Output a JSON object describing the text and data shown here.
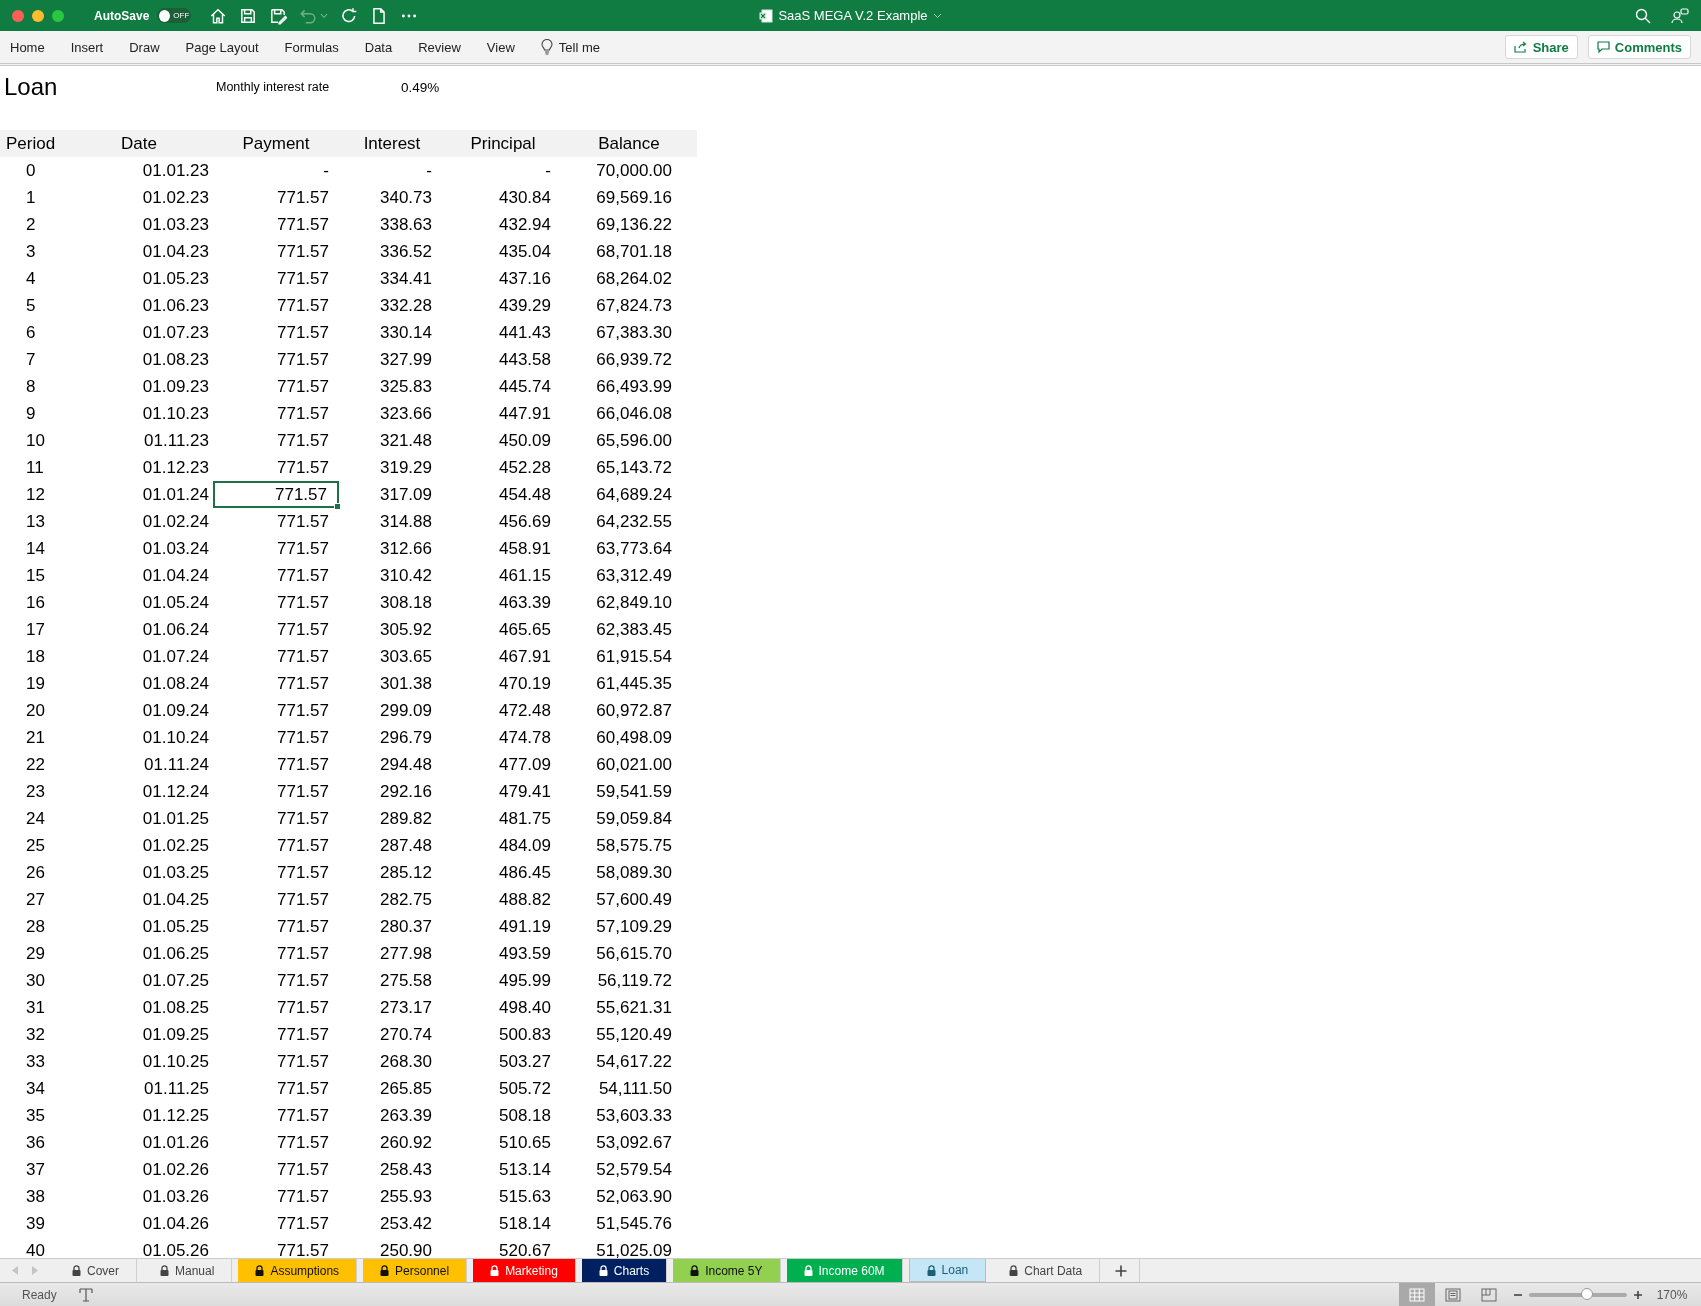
{
  "titlebar": {
    "autosave": {
      "label": "AutoSave",
      "state_text": "OFF",
      "on": false
    },
    "toolbar": [
      {
        "kind": "home",
        "disabled": false
      },
      {
        "kind": "save",
        "disabled": false
      },
      {
        "kind": "save-edit",
        "disabled": false
      },
      {
        "kind": "undo",
        "disabled": true
      },
      {
        "kind": "redo",
        "disabled": false
      },
      {
        "kind": "new",
        "disabled": false
      },
      {
        "kind": "more",
        "disabled": false
      }
    ],
    "title": "SaaS MEGA V.2 Example"
  },
  "ribbon": {
    "tabs": [
      "Home",
      "Insert",
      "Draw",
      "Page Layout",
      "Formulas",
      "Data",
      "Review",
      "View"
    ],
    "tell_me": "Tell me",
    "share": "Share",
    "comments": "Comments"
  },
  "sheet": {
    "title": "Loan",
    "rate_label": "Monthly interest rate",
    "rate_value": "0.49%",
    "columns": [
      "Period",
      "Date",
      "Payment",
      "Interest",
      "Principal",
      "Balance"
    ],
    "rows": [
      {
        "period": "0",
        "date": "01.01.23",
        "payment": "-",
        "interest": "-",
        "principal": "-",
        "balance": "70,000.00",
        "payment_selected": false
      },
      {
        "period": "1",
        "date": "01.02.23",
        "payment": "771.57",
        "interest": "340.73",
        "principal": "430.84",
        "balance": "69,569.16",
        "payment_selected": false
      },
      {
        "period": "2",
        "date": "01.03.23",
        "payment": "771.57",
        "interest": "338.63",
        "principal": "432.94",
        "balance": "69,136.22",
        "payment_selected": false
      },
      {
        "period": "3",
        "date": "01.04.23",
        "payment": "771.57",
        "interest": "336.52",
        "principal": "435.04",
        "balance": "68,701.18",
        "payment_selected": false
      },
      {
        "period": "4",
        "date": "01.05.23",
        "payment": "771.57",
        "interest": "334.41",
        "principal": "437.16",
        "balance": "68,264.02",
        "payment_selected": false
      },
      {
        "period": "5",
        "date": "01.06.23",
        "payment": "771.57",
        "interest": "332.28",
        "principal": "439.29",
        "balance": "67,824.73",
        "payment_selected": false
      },
      {
        "period": "6",
        "date": "01.07.23",
        "payment": "771.57",
        "interest": "330.14",
        "principal": "441.43",
        "balance": "67,383.30",
        "payment_selected": false
      },
      {
        "period": "7",
        "date": "01.08.23",
        "payment": "771.57",
        "interest": "327.99",
        "principal": "443.58",
        "balance": "66,939.72",
        "payment_selected": false
      },
      {
        "period": "8",
        "date": "01.09.23",
        "payment": "771.57",
        "interest": "325.83",
        "principal": "445.74",
        "balance": "66,493.99",
        "payment_selected": false
      },
      {
        "period": "9",
        "date": "01.10.23",
        "payment": "771.57",
        "interest": "323.66",
        "principal": "447.91",
        "balance": "66,046.08",
        "payment_selected": false
      },
      {
        "period": "10",
        "date": "01.11.23",
        "payment": "771.57",
        "interest": "321.48",
        "principal": "450.09",
        "balance": "65,596.00",
        "payment_selected": false
      },
      {
        "period": "11",
        "date": "01.12.23",
        "payment": "771.57",
        "interest": "319.29",
        "principal": "452.28",
        "balance": "65,143.72",
        "payment_selected": false
      },
      {
        "period": "12",
        "date": "01.01.24",
        "payment": "771.57",
        "interest": "317.09",
        "principal": "454.48",
        "balance": "64,689.24",
        "payment_selected": true
      },
      {
        "period": "13",
        "date": "01.02.24",
        "payment": "771.57",
        "interest": "314.88",
        "principal": "456.69",
        "balance": "64,232.55",
        "payment_selected": false
      },
      {
        "period": "14",
        "date": "01.03.24",
        "payment": "771.57",
        "interest": "312.66",
        "principal": "458.91",
        "balance": "63,773.64",
        "payment_selected": false
      },
      {
        "period": "15",
        "date": "01.04.24",
        "payment": "771.57",
        "interest": "310.42",
        "principal": "461.15",
        "balance": "63,312.49",
        "payment_selected": false
      },
      {
        "period": "16",
        "date": "01.05.24",
        "payment": "771.57",
        "interest": "308.18",
        "principal": "463.39",
        "balance": "62,849.10",
        "payment_selected": false
      },
      {
        "period": "17",
        "date": "01.06.24",
        "payment": "771.57",
        "interest": "305.92",
        "principal": "465.65",
        "balance": "62,383.45",
        "payment_selected": false
      },
      {
        "period": "18",
        "date": "01.07.24",
        "payment": "771.57",
        "interest": "303.65",
        "principal": "467.91",
        "balance": "61,915.54",
        "payment_selected": false
      },
      {
        "period": "19",
        "date": "01.08.24",
        "payment": "771.57",
        "interest": "301.38",
        "principal": "470.19",
        "balance": "61,445.35",
        "payment_selected": false
      },
      {
        "period": "20",
        "date": "01.09.24",
        "payment": "771.57",
        "interest": "299.09",
        "principal": "472.48",
        "balance": "60,972.87",
        "payment_selected": false
      },
      {
        "period": "21",
        "date": "01.10.24",
        "payment": "771.57",
        "interest": "296.79",
        "principal": "474.78",
        "balance": "60,498.09",
        "payment_selected": false
      },
      {
        "period": "22",
        "date": "01.11.24",
        "payment": "771.57",
        "interest": "294.48",
        "principal": "477.09",
        "balance": "60,021.00",
        "payment_selected": false
      },
      {
        "period": "23",
        "date": "01.12.24",
        "payment": "771.57",
        "interest": "292.16",
        "principal": "479.41",
        "balance": "59,541.59",
        "payment_selected": false
      },
      {
        "period": "24",
        "date": "01.01.25",
        "payment": "771.57",
        "interest": "289.82",
        "principal": "481.75",
        "balance": "59,059.84",
        "payment_selected": false
      },
      {
        "period": "25",
        "date": "01.02.25",
        "payment": "771.57",
        "interest": "287.48",
        "principal": "484.09",
        "balance": "58,575.75",
        "payment_selected": false
      },
      {
        "period": "26",
        "date": "01.03.25",
        "payment": "771.57",
        "interest": "285.12",
        "principal": "486.45",
        "balance": "58,089.30",
        "payment_selected": false
      },
      {
        "period": "27",
        "date": "01.04.25",
        "payment": "771.57",
        "interest": "282.75",
        "principal": "488.82",
        "balance": "57,600.49",
        "payment_selected": false
      },
      {
        "period": "28",
        "date": "01.05.25",
        "payment": "771.57",
        "interest": "280.37",
        "principal": "491.19",
        "balance": "57,109.29",
        "payment_selected": false
      },
      {
        "period": "29",
        "date": "01.06.25",
        "payment": "771.57",
        "interest": "277.98",
        "principal": "493.59",
        "balance": "56,615.70",
        "payment_selected": false
      },
      {
        "period": "30",
        "date": "01.07.25",
        "payment": "771.57",
        "interest": "275.58",
        "principal": "495.99",
        "balance": "56,119.72",
        "payment_selected": false
      },
      {
        "period": "31",
        "date": "01.08.25",
        "payment": "771.57",
        "interest": "273.17",
        "principal": "498.40",
        "balance": "55,621.31",
        "payment_selected": false
      },
      {
        "period": "32",
        "date": "01.09.25",
        "payment": "771.57",
        "interest": "270.74",
        "principal": "500.83",
        "balance": "55,120.49",
        "payment_selected": false
      },
      {
        "period": "33",
        "date": "01.10.25",
        "payment": "771.57",
        "interest": "268.30",
        "principal": "503.27",
        "balance": "54,617.22",
        "payment_selected": false
      },
      {
        "period": "34",
        "date": "01.11.25",
        "payment": "771.57",
        "interest": "265.85",
        "principal": "505.72",
        "balance": "54,111.50",
        "payment_selected": false
      },
      {
        "period": "35",
        "date": "01.12.25",
        "payment": "771.57",
        "interest": "263.39",
        "principal": "508.18",
        "balance": "53,603.33",
        "payment_selected": false
      },
      {
        "period": "36",
        "date": "01.01.26",
        "payment": "771.57",
        "interest": "260.92",
        "principal": "510.65",
        "balance": "53,092.67",
        "payment_selected": false
      },
      {
        "period": "37",
        "date": "01.02.26",
        "payment": "771.57",
        "interest": "258.43",
        "principal": "513.14",
        "balance": "52,579.54",
        "payment_selected": false
      },
      {
        "period": "38",
        "date": "01.03.26",
        "payment": "771.57",
        "interest": "255.93",
        "principal": "515.63",
        "balance": "52,063.90",
        "payment_selected": false
      },
      {
        "period": "39",
        "date": "01.04.26",
        "payment": "771.57",
        "interest": "253.42",
        "principal": "518.14",
        "balance": "51,545.76",
        "payment_selected": false
      },
      {
        "period": "40",
        "date": "01.05.26",
        "payment": "771.57",
        "interest": "250.90",
        "principal": "520.67",
        "balance": "51,025.09",
        "payment_selected": false
      }
    ]
  },
  "sheet_tabs": [
    {
      "label": "Cover",
      "selected": false
    },
    {
      "label": "Manual",
      "selected": false
    },
    {
      "label": "Assumptions",
      "selected": false,
      "color": "#ffc000"
    },
    {
      "label": "Personnel",
      "selected": false,
      "color": "#ffc000"
    },
    {
      "label": "Marketing",
      "selected": false,
      "color": "#ff0000"
    },
    {
      "label": "Charts",
      "selected": false,
      "color": "#002060"
    },
    {
      "label": "Income 5Y",
      "selected": false,
      "color": "#92d050"
    },
    {
      "label": "Income 60M",
      "selected": false,
      "color": "#00b050"
    },
    {
      "label": "Loan",
      "selected": true,
      "color": "#c4e6f6"
    },
    {
      "label": "Chart Data",
      "selected": false
    }
  ],
  "status_bar": {
    "status": "Ready",
    "views": [
      {
        "kind": "normal",
        "selected": true
      },
      {
        "kind": "page-layout",
        "selected": false
      },
      {
        "kind": "page-break",
        "selected": false
      }
    ],
    "zoom": {
      "level": 0.6,
      "reading": "170%"
    }
  }
}
